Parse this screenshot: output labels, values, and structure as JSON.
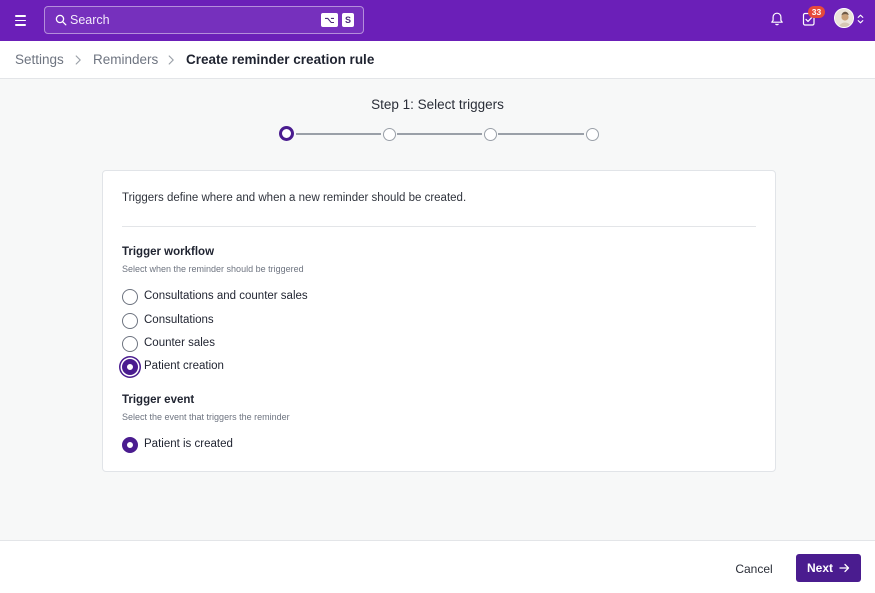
{
  "topbar": {
    "menu_icon": "hamburger-icon",
    "search": {
      "placeholder": "Search",
      "icon": "search-icon",
      "shortcut_key1": "⌥",
      "shortcut_key2": "S"
    },
    "notifications_icon": "bell-icon",
    "tasks_icon": "tasks-check-icon",
    "tasks_badge": "33",
    "avatar_icon": "user-avatar",
    "brand_color": "#6b1fb8"
  },
  "breadcrumb": {
    "items": [
      "Settings",
      "Reminders"
    ],
    "current": "Create reminder creation rule"
  },
  "stepper": {
    "title": "Step 1: Select triggers",
    "active_step": 1,
    "total_steps": 4
  },
  "card": {
    "intro": "Triggers define where and when a new reminder should be created.",
    "workflow": {
      "title": "Trigger workflow",
      "subtitle": "Select when the reminder should be triggered",
      "options": [
        {
          "label": "Consultations and counter sales",
          "checked": false
        },
        {
          "label": "Consultations",
          "checked": false
        },
        {
          "label": "Counter sales",
          "checked": false
        },
        {
          "label": "Patient creation",
          "checked": true
        }
      ]
    },
    "event": {
      "title": "Trigger event",
      "subtitle": "Select the event that triggers the reminder",
      "options": [
        {
          "label": "Patient is created",
          "checked": true
        }
      ]
    }
  },
  "footer": {
    "cancel_label": "Cancel",
    "next_label": "Next",
    "accent_color": "#4a1c8f"
  }
}
